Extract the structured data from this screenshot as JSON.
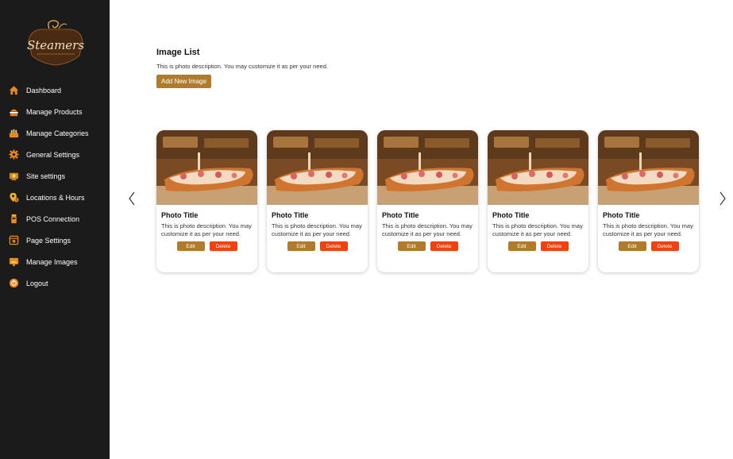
{
  "brand": {
    "name": "Steamers"
  },
  "sidebar": {
    "items": [
      {
        "label": "Dashboard",
        "icon": "home-icon",
        "color": "#e98a1f"
      },
      {
        "label": "Manage Products",
        "icon": "products-icon",
        "color": "#e98a1f"
      },
      {
        "label": "Manage Categories",
        "icon": "categories-icon",
        "color": "#e98a1f"
      },
      {
        "label": "General Settings",
        "icon": "gear-icon",
        "color": "#e98a1f"
      },
      {
        "label": "Site settings",
        "icon": "site-settings-icon",
        "color": "#e98a1f"
      },
      {
        "label": "Locations & Hours",
        "icon": "location-icon",
        "color": "#e98a1f"
      },
      {
        "label": "POS Connection",
        "icon": "pos-icon",
        "color": "#e98a1f"
      },
      {
        "label": "Page Settings",
        "icon": "page-settings-icon",
        "color": "#e98a1f"
      },
      {
        "label": "Manage Images",
        "icon": "images-icon",
        "color": "#e98a1f"
      },
      {
        "label": "Logout",
        "icon": "logout-icon",
        "color": "#e98a1f"
      }
    ]
  },
  "main": {
    "title": "Image List",
    "description": "This is photo description. You may customize it as per your need.",
    "add_button": "Add New Image",
    "cards": [
      {
        "title": "Photo Title",
        "description": "This is photo description. You may customize it as per your need.",
        "edit": "Edit",
        "delete": "Delete"
      },
      {
        "title": "Photo Title",
        "description": "This is photo description. You may customize it as per your need.",
        "edit": "Edit",
        "delete": "Delete"
      },
      {
        "title": "Photo Title",
        "description": "This is photo description. You may customize it as per your need.",
        "edit": "Edit",
        "delete": "Delete"
      },
      {
        "title": "Photo Title",
        "description": "This is photo description. You may customize it as per your need.",
        "edit": "Edit",
        "delete": "Delete"
      },
      {
        "title": "Photo Title",
        "description": "This is photo description. You may customize it as per your need.",
        "edit": "Edit",
        "delete": "Delete"
      }
    ]
  },
  "colors": {
    "accent": "#b07c2c",
    "danger": "#f1410e",
    "sidebar_bg": "#1b1b1b"
  }
}
